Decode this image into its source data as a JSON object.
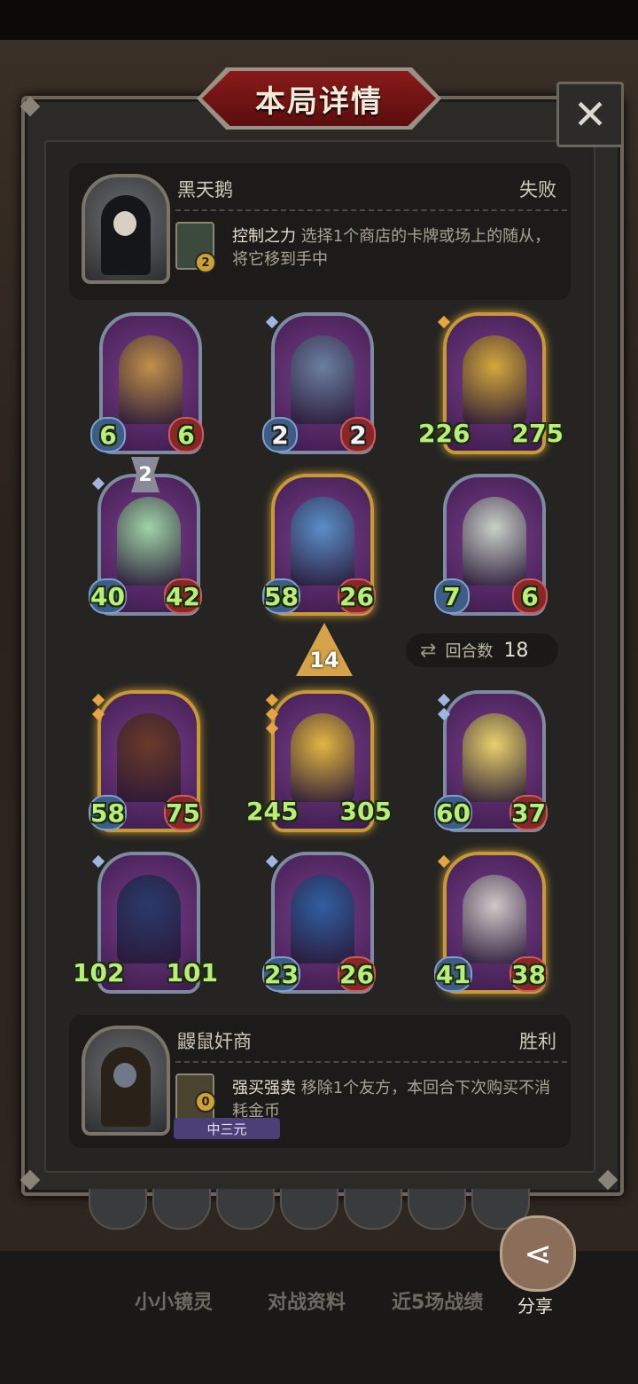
{
  "header": {
    "title": "本局详情",
    "close_icon": "close-icon"
  },
  "top_player": {
    "name": "黑天鹅",
    "result": "失败",
    "skill_name": "控制之力",
    "skill_desc": "选择1个商店的卡牌或场上的随从，将它移到手中",
    "skill_badge": "2"
  },
  "top_board": [
    {
      "atk": "6",
      "hp": "6",
      "frame": "diamond",
      "gems": []
    },
    {
      "atk": "2",
      "hp": "2",
      "frame": "diamond",
      "gems": [
        "blue"
      ]
    },
    {
      "atk": "226",
      "hp": "275",
      "frame": "gold",
      "gems": [
        "gold"
      ]
    },
    {
      "atk": "40",
      "hp": "42",
      "frame": "diamond",
      "gems": [
        "blue"
      ]
    },
    {
      "atk": "58",
      "hp": "26",
      "frame": "gold",
      "gems": []
    },
    {
      "atk": "7",
      "hp": "6",
      "frame": "diamond",
      "gems": []
    }
  ],
  "level_badge": "2",
  "tier_badge": "14",
  "rounds": {
    "label": "回合数",
    "value": "18"
  },
  "bottom_board": [
    {
      "atk": "58",
      "hp": "75",
      "frame": "gold",
      "gems": [
        "gold",
        "gold"
      ]
    },
    {
      "atk": "245",
      "hp": "305",
      "frame": "gold",
      "gems": [
        "gold",
        "gold",
        "gold"
      ]
    },
    {
      "atk": "60",
      "hp": "37",
      "frame": "diamond",
      "gems": [
        "blue",
        "blue"
      ]
    },
    {
      "atk": "102",
      "hp": "101",
      "frame": "diamond",
      "gems": [
        "blue"
      ]
    },
    {
      "atk": "23",
      "hp": "26",
      "frame": "diamond",
      "gems": [
        "blue"
      ]
    },
    {
      "atk": "41",
      "hp": "38",
      "frame": "gold",
      "gems": [
        "gold"
      ]
    }
  ],
  "bottom_player": {
    "name": "鼹鼠奸商",
    "result": "胜利",
    "skill_name": "强买强卖",
    "skill_desc": "移除1个友方，本回合下次购买不消耗金币",
    "skill_badge": "0",
    "rank": "中三元"
  },
  "bottom_tabs": [
    "小小镜灵",
    "对战资料",
    "近5场战绩"
  ],
  "share_label": "分享",
  "colors": {
    "win_lose_text": "#cfc8bc",
    "stat_green": "#b9ee79",
    "gold_frame": "#c79a38",
    "title_red": "#8a1a1a"
  }
}
